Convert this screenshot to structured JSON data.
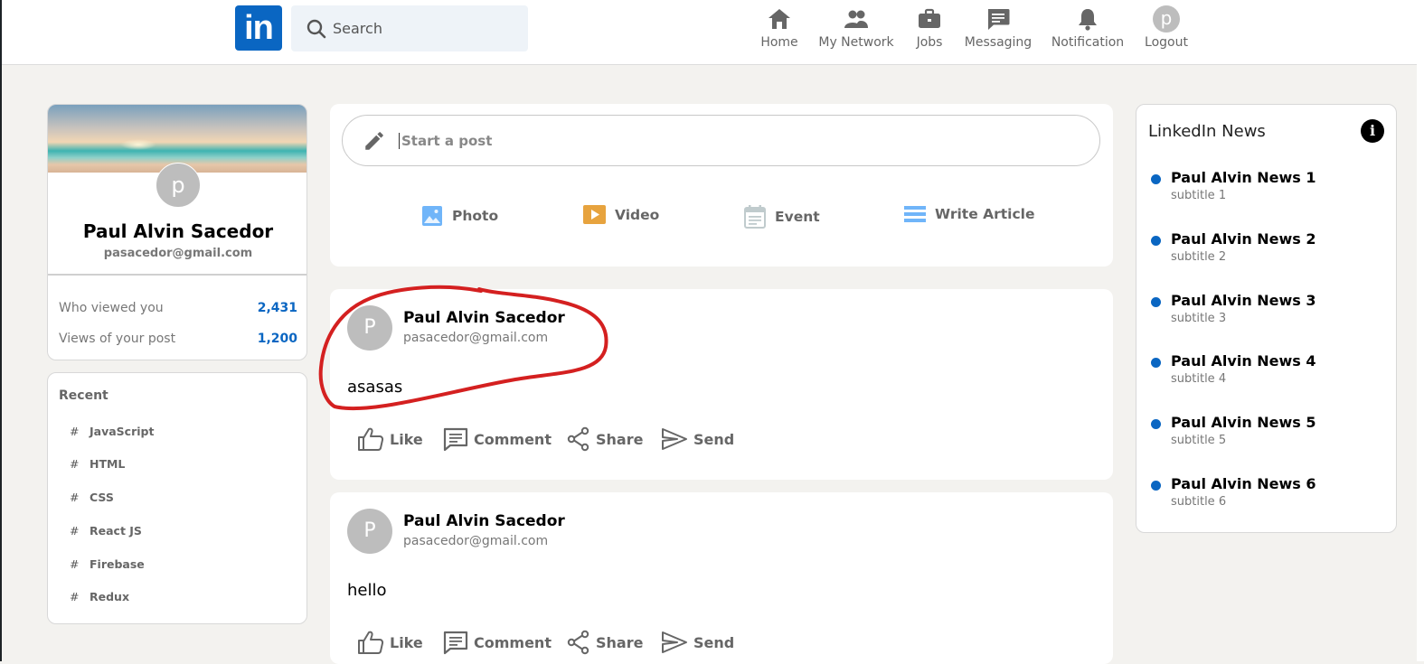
{
  "header": {
    "logo_text": "in",
    "search_placeholder": "Search",
    "nav": [
      {
        "label": "Home",
        "icon": "home-icon"
      },
      {
        "label": "My Network",
        "icon": "network-icon"
      },
      {
        "label": "Jobs",
        "icon": "briefcase-icon"
      },
      {
        "label": "Messaging",
        "icon": "message-icon"
      },
      {
        "label": "Notification",
        "icon": "bell-icon"
      },
      {
        "label": "Logout",
        "icon": "avatar",
        "avatar_letter": "p"
      }
    ]
  },
  "profile": {
    "avatar_letter": "p",
    "name": "Paul Alvin Sacedor",
    "email": "pasacedor@gmail.com",
    "stats": [
      {
        "label": "Who viewed you",
        "value": "2,431"
      },
      {
        "label": "Views of your post",
        "value": "1,200"
      }
    ]
  },
  "recent": {
    "title": "Recent",
    "items": [
      "JavaScript",
      "HTML",
      "CSS",
      "React JS",
      "Firebase",
      "Redux"
    ]
  },
  "post_box": {
    "placeholder": "Start a post",
    "options": [
      {
        "label": "Photo",
        "icon": "photo-icon",
        "color": "#70b5f9"
      },
      {
        "label": "Video",
        "icon": "video-icon",
        "color": "#e7a33e"
      },
      {
        "label": "Event",
        "icon": "event-icon",
        "color": "#c0cbcd"
      },
      {
        "label": "Write Article",
        "icon": "article-icon",
        "color": "#7fc15e"
      }
    ]
  },
  "posts": [
    {
      "avatar_letter": "P",
      "name": "Paul Alvin Sacedor",
      "email": "pasacedor@gmail.com",
      "message": "asasas"
    },
    {
      "avatar_letter": "P",
      "name": "Paul Alvin Sacedor",
      "email": "pasacedor@gmail.com",
      "message": "hello"
    }
  ],
  "post_actions": [
    "Like",
    "Comment",
    "Share",
    "Send"
  ],
  "news": {
    "title": "LinkedIn News",
    "info_glyph": "i",
    "items": [
      {
        "heading": "Paul Alvin News 1",
        "subtitle": "subtitle 1"
      },
      {
        "heading": "Paul Alvin News 2",
        "subtitle": "subtitle 2"
      },
      {
        "heading": "Paul Alvin News 3",
        "subtitle": "subtitle 3"
      },
      {
        "heading": "Paul Alvin News 4",
        "subtitle": "subtitle 4"
      },
      {
        "heading": "Paul Alvin News 5",
        "subtitle": "subtitle 5"
      },
      {
        "heading": "Paul Alvin News 6",
        "subtitle": "subtitle 6"
      }
    ]
  },
  "colors": {
    "brand": "#0a66c2",
    "background": "#f3f2ef",
    "annotation": "#d42020"
  }
}
